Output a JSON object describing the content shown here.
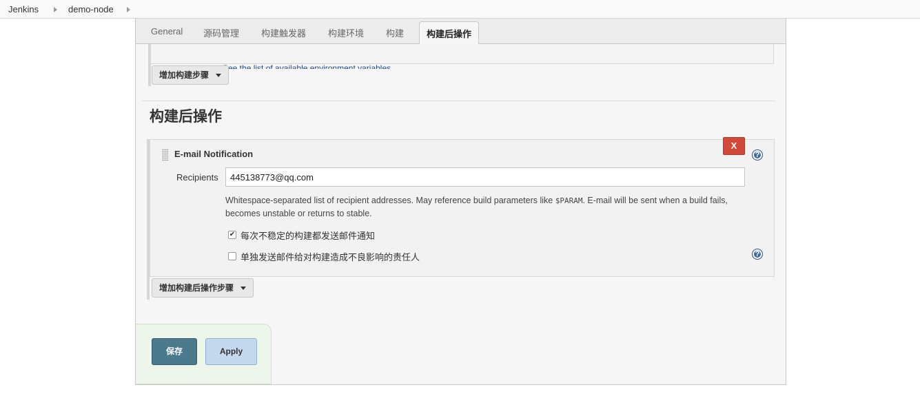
{
  "breadcrumb": {
    "items": [
      "Jenkins",
      "demo-node"
    ]
  },
  "tabs": [
    {
      "label": "General",
      "active": false
    },
    {
      "label": "源码管理",
      "active": false
    },
    {
      "label": "构建触发器",
      "active": false
    },
    {
      "label": "构建环境",
      "active": false
    },
    {
      "label": "构建",
      "active": false
    },
    {
      "label": "构建后操作",
      "active": true
    }
  ],
  "build_section": {
    "env_link_text": "See the list of available environment variables",
    "add_step_label": "增加构建步骤"
  },
  "post_build": {
    "title": "构建后操作",
    "email_notification": {
      "title": "E-mail Notification",
      "delete_label": "X",
      "recipients_label": "Recipients",
      "recipients_value": "445138773@qq.com",
      "description_before": "Whitespace-separated list of recipient addresses. May reference build parameters like ",
      "description_code": "$PARAM",
      "description_after": ". E-mail will be sent when a build fails, becomes unstable or returns to stable.",
      "option_unstable": {
        "label": "每次不稳定的构建都发送邮件通知",
        "checked": true
      },
      "option_separate": {
        "label": "单独发送邮件给对构建造成不良影响的责任人",
        "checked": false
      }
    },
    "add_step_label": "增加构建后操作步骤"
  },
  "actions": {
    "save_label": "保存",
    "apply_label": "Apply"
  },
  "icons": {
    "help": "?",
    "check": "✔"
  },
  "colors": {
    "delete": "#d24939",
    "save": "#4a7a8c",
    "apply": "#c4d9ee",
    "help": "#3d6b9c"
  }
}
